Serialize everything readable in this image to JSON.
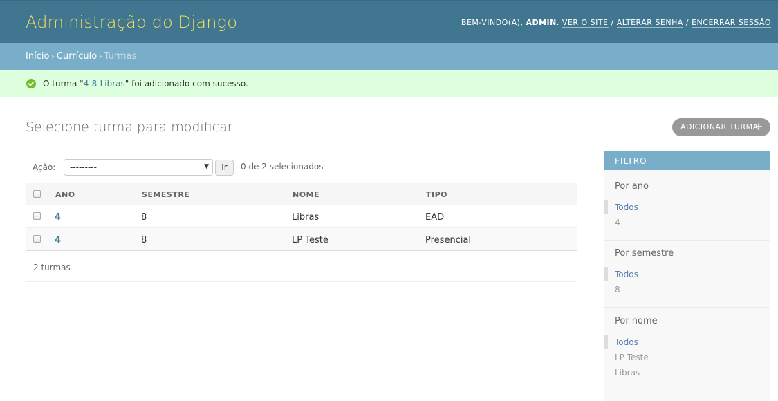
{
  "header": {
    "branding": "Administração do Django",
    "welcome": "BEM-VINDO(A),",
    "username": "ADMIN",
    "view_site": "VER O SITE",
    "change_password": "ALTERAR SENHA",
    "logout": "ENCERRAR SESSÃO",
    "separator": "/"
  },
  "breadcrumbs": {
    "items": [
      "Início",
      "Currículo"
    ],
    "current": "Turmas",
    "separator": "›"
  },
  "message": {
    "prefix": "O turma \"",
    "link": "4-8-Libras",
    "suffix": "\" foi adicionado com sucesso."
  },
  "page": {
    "title": "Selecione turma para modificar",
    "add_button": "ADICIONAR TURMA",
    "add_icon": "+"
  },
  "actions": {
    "label": "Ação:",
    "selected_value": "---------",
    "go_button": "Ir",
    "counter": "0 de 2 selecionados"
  },
  "table": {
    "headers": [
      "ANO",
      "SEMESTRE",
      "NOME",
      "TIPO"
    ],
    "rows": [
      {
        "ano": "4",
        "semestre": "8",
        "nome": "Libras",
        "tipo": "EAD"
      },
      {
        "ano": "4",
        "semestre": "8",
        "nome": "LP Teste",
        "tipo": "Presencial"
      }
    ]
  },
  "paginator": "2 turmas",
  "filter": {
    "title": "FILTRO",
    "groups": [
      {
        "title": "Por ano",
        "options": [
          "Todos",
          "4"
        ]
      },
      {
        "title": "Por semestre",
        "options": [
          "Todos",
          "8"
        ]
      },
      {
        "title": "Por nome",
        "options": [
          "Todos",
          "LP Teste",
          "Libras"
        ]
      }
    ]
  },
  "colors": {
    "header_bg": "#417690",
    "branding": "#f5dd5d",
    "breadcrumbs_bg": "#79aec8",
    "success_bg": "#ddffdd",
    "success_icon": "#70bf2b",
    "link": "#447e9b",
    "add_button_bg": "#999999"
  },
  "icons": {
    "message": "success-check-circle-icon",
    "select_arrow": "triangle-down-icon",
    "add": "plus-icon"
  }
}
